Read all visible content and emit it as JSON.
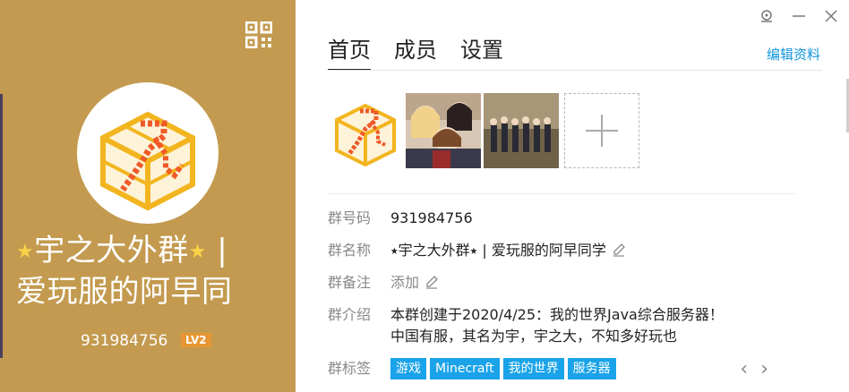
{
  "profile": {
    "name_star": "★",
    "name_part1": "宇之大外群",
    "name_separator": "|",
    "name_part2": "爱玩服的阿早同",
    "group_id": "931984756",
    "level": "LV2"
  },
  "tabs": [
    {
      "label": "首页",
      "active": true
    },
    {
      "label": "成员",
      "active": false
    },
    {
      "label": "设置",
      "active": false
    }
  ],
  "edit_profile_label": "编辑资料",
  "info": {
    "id_label": "群号码",
    "id_value": "931984756",
    "name_label": "群名称",
    "name_value": "⭑宇之大外群⭑ | 爱玩服的阿早同学",
    "note_label": "群备注",
    "note_value": "添加",
    "intro_label": "群介绍",
    "intro_line1": "本群创建于2020/4/25：我的世界Java综合服务器！",
    "intro_line2": "中国有服，其名为宇，宇之大，不知多好玩也",
    "tags_label": "群标签",
    "tags": [
      "游戏",
      "Minecraft",
      "我的世界",
      "服务器"
    ]
  },
  "colors": {
    "left_bg": "#c39a4f",
    "accent_blue": "#1296db",
    "tag_bg": "#1aa3e8",
    "level_badge": "#e89634"
  }
}
